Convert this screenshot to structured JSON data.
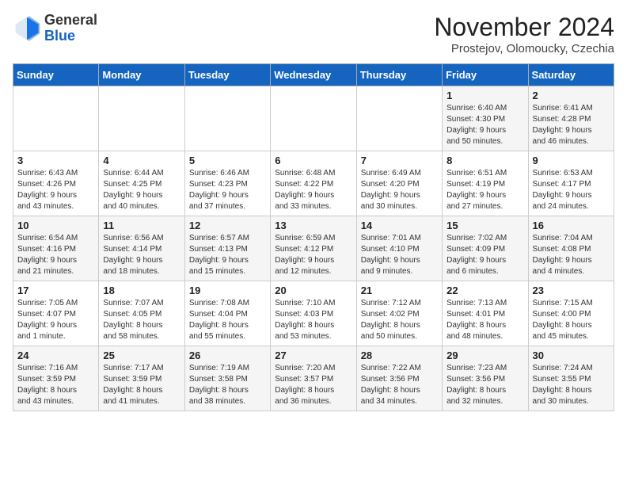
{
  "header": {
    "logo_line1": "General",
    "logo_line2": "Blue",
    "month_title": "November 2024",
    "subtitle": "Prostejov, Olomoucky, Czechia"
  },
  "days_of_week": [
    "Sunday",
    "Monday",
    "Tuesday",
    "Wednesday",
    "Thursday",
    "Friday",
    "Saturday"
  ],
  "weeks": [
    [
      {
        "day": "",
        "info": ""
      },
      {
        "day": "",
        "info": ""
      },
      {
        "day": "",
        "info": ""
      },
      {
        "day": "",
        "info": ""
      },
      {
        "day": "",
        "info": ""
      },
      {
        "day": "1",
        "info": "Sunrise: 6:40 AM\nSunset: 4:30 PM\nDaylight: 9 hours\nand 50 minutes."
      },
      {
        "day": "2",
        "info": "Sunrise: 6:41 AM\nSunset: 4:28 PM\nDaylight: 9 hours\nand 46 minutes."
      }
    ],
    [
      {
        "day": "3",
        "info": "Sunrise: 6:43 AM\nSunset: 4:26 PM\nDaylight: 9 hours\nand 43 minutes."
      },
      {
        "day": "4",
        "info": "Sunrise: 6:44 AM\nSunset: 4:25 PM\nDaylight: 9 hours\nand 40 minutes."
      },
      {
        "day": "5",
        "info": "Sunrise: 6:46 AM\nSunset: 4:23 PM\nDaylight: 9 hours\nand 37 minutes."
      },
      {
        "day": "6",
        "info": "Sunrise: 6:48 AM\nSunset: 4:22 PM\nDaylight: 9 hours\nand 33 minutes."
      },
      {
        "day": "7",
        "info": "Sunrise: 6:49 AM\nSunset: 4:20 PM\nDaylight: 9 hours\nand 30 minutes."
      },
      {
        "day": "8",
        "info": "Sunrise: 6:51 AM\nSunset: 4:19 PM\nDaylight: 9 hours\nand 27 minutes."
      },
      {
        "day": "9",
        "info": "Sunrise: 6:53 AM\nSunset: 4:17 PM\nDaylight: 9 hours\nand 24 minutes."
      }
    ],
    [
      {
        "day": "10",
        "info": "Sunrise: 6:54 AM\nSunset: 4:16 PM\nDaylight: 9 hours\nand 21 minutes."
      },
      {
        "day": "11",
        "info": "Sunrise: 6:56 AM\nSunset: 4:14 PM\nDaylight: 9 hours\nand 18 minutes."
      },
      {
        "day": "12",
        "info": "Sunrise: 6:57 AM\nSunset: 4:13 PM\nDaylight: 9 hours\nand 15 minutes."
      },
      {
        "day": "13",
        "info": "Sunrise: 6:59 AM\nSunset: 4:12 PM\nDaylight: 9 hours\nand 12 minutes."
      },
      {
        "day": "14",
        "info": "Sunrise: 7:01 AM\nSunset: 4:10 PM\nDaylight: 9 hours\nand 9 minutes."
      },
      {
        "day": "15",
        "info": "Sunrise: 7:02 AM\nSunset: 4:09 PM\nDaylight: 9 hours\nand 6 minutes."
      },
      {
        "day": "16",
        "info": "Sunrise: 7:04 AM\nSunset: 4:08 PM\nDaylight: 9 hours\nand 4 minutes."
      }
    ],
    [
      {
        "day": "17",
        "info": "Sunrise: 7:05 AM\nSunset: 4:07 PM\nDaylight: 9 hours\nand 1 minute."
      },
      {
        "day": "18",
        "info": "Sunrise: 7:07 AM\nSunset: 4:05 PM\nDaylight: 8 hours\nand 58 minutes."
      },
      {
        "day": "19",
        "info": "Sunrise: 7:08 AM\nSunset: 4:04 PM\nDaylight: 8 hours\nand 55 minutes."
      },
      {
        "day": "20",
        "info": "Sunrise: 7:10 AM\nSunset: 4:03 PM\nDaylight: 8 hours\nand 53 minutes."
      },
      {
        "day": "21",
        "info": "Sunrise: 7:12 AM\nSunset: 4:02 PM\nDaylight: 8 hours\nand 50 minutes."
      },
      {
        "day": "22",
        "info": "Sunrise: 7:13 AM\nSunset: 4:01 PM\nDaylight: 8 hours\nand 48 minutes."
      },
      {
        "day": "23",
        "info": "Sunrise: 7:15 AM\nSunset: 4:00 PM\nDaylight: 8 hours\nand 45 minutes."
      }
    ],
    [
      {
        "day": "24",
        "info": "Sunrise: 7:16 AM\nSunset: 3:59 PM\nDaylight: 8 hours\nand 43 minutes."
      },
      {
        "day": "25",
        "info": "Sunrise: 7:17 AM\nSunset: 3:59 PM\nDaylight: 8 hours\nand 41 minutes."
      },
      {
        "day": "26",
        "info": "Sunrise: 7:19 AM\nSunset: 3:58 PM\nDaylight: 8 hours\nand 38 minutes."
      },
      {
        "day": "27",
        "info": "Sunrise: 7:20 AM\nSunset: 3:57 PM\nDaylight: 8 hours\nand 36 minutes."
      },
      {
        "day": "28",
        "info": "Sunrise: 7:22 AM\nSunset: 3:56 PM\nDaylight: 8 hours\nand 34 minutes."
      },
      {
        "day": "29",
        "info": "Sunrise: 7:23 AM\nSunset: 3:56 PM\nDaylight: 8 hours\nand 32 minutes."
      },
      {
        "day": "30",
        "info": "Sunrise: 7:24 AM\nSunset: 3:55 PM\nDaylight: 8 hours\nand 30 minutes."
      }
    ]
  ]
}
